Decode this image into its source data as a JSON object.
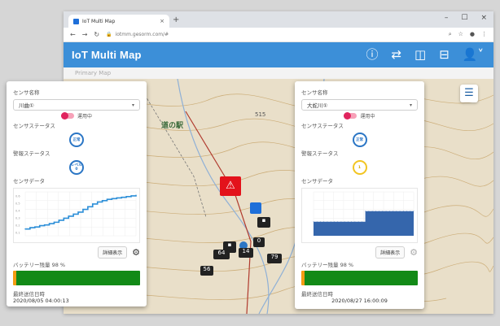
{
  "browser": {
    "tab_title": "IoT Multi Map",
    "tab_close": "×",
    "new_tab": "+",
    "url": "iotmm.gesorm.com/#",
    "nav_icons": [
      "back-arrow",
      "forward-arrow",
      "reload"
    ],
    "window_controls": [
      "–",
      "☐",
      "×"
    ]
  },
  "app": {
    "title": "IoT Multi Map",
    "accent_color": "#3c8fd8",
    "subbar_text": "Primary Map"
  },
  "left_panel": {
    "sensor_name_label": "センサ名称",
    "sensor_name_value": "川曲①",
    "toggle_label": "運用中",
    "sensor_status_label": "センサステータス",
    "sensor_status_value": "正常",
    "alarm_status_label": "警報ステータス",
    "alarm_status_value": "レベル\n0",
    "sensor_data_label": "センサデータ",
    "detail_button": "詳細表示",
    "battery_label": "バッテリー残量 98 %",
    "battery_color": "#128a17",
    "last_sent_label": "最終送信日時",
    "last_sent_value": "2020/08/05 04:00:13",
    "chart_data": {
      "type": "line",
      "values": [
        1,
        1.2,
        1.3,
        1.5,
        1.6,
        1.8,
        2.0,
        2.3,
        2.6,
        2.9,
        3.2,
        3.5,
        3.9,
        4.3,
        4.7,
        5.0,
        5.2,
        5.4,
        5.5,
        5.6,
        5.7,
        5.8,
        5.9,
        6.0
      ],
      "ylim": [
        0,
        6.5
      ],
      "y_tick_labels": [
        "0.6",
        "0.5",
        "0.4",
        "0.3",
        "0.2",
        "0.1"
      ],
      "color": "#2d8fd8"
    }
  },
  "right_panel": {
    "sensor_name_label": "センサ名称",
    "sensor_name_value": "大蛇川①",
    "toggle_label": "運用中",
    "sensor_status_label": "センサステータス",
    "sensor_status_value": "正常",
    "alarm_status_label": "警報ステータス",
    "alarm_status_value": "1",
    "sensor_data_label": "センサデータ",
    "detail_button": "詳細表示",
    "battery_label": "バッテリー残量 98 %",
    "battery_color": "#128a17",
    "last_sent_label": "最終送信日時",
    "last_sent_value": "2020/08/27 16:00:09",
    "chart_data": {
      "type": "area",
      "values": [
        1.6,
        1.6,
        1.6,
        1.6,
        1.6,
        1.6,
        1.6,
        1.6,
        1.6,
        1.6,
        1.6,
        1.6,
        1.6,
        1.6,
        1.6,
        2.8,
        2.8,
        2.8,
        2.8,
        2.8,
        2.8,
        2.8,
        2.8,
        2.8,
        2.8,
        2.8,
        2.8,
        2.8,
        2.8,
        2.8
      ],
      "ylim": [
        0,
        5
      ],
      "color": "#2a5ea8"
    }
  },
  "map": {
    "labels": [
      "道の駅",
      "515"
    ],
    "marker_counts": [
      "64",
      "14",
      "79",
      "56",
      "0"
    ]
  }
}
